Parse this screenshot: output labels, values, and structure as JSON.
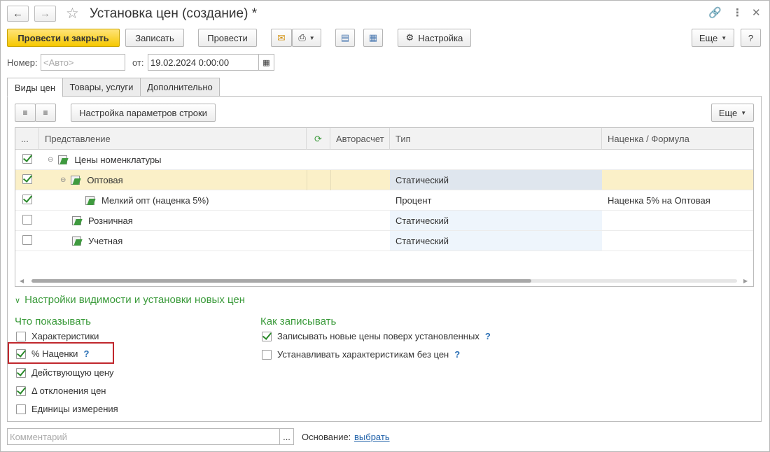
{
  "window": {
    "title": "Установка цен (создание) *"
  },
  "toolbar": {
    "post_close": "Провести и закрыть",
    "save": "Записать",
    "post": "Провести",
    "settings": "Настройка",
    "more": "Еще",
    "help": "?"
  },
  "header_fields": {
    "number_label": "Номер:",
    "number_placeholder": "<Авто>",
    "date_label": "от:",
    "date_value": "19.02.2024  0:00:00"
  },
  "tabs": [
    {
      "label": "Виды цен"
    },
    {
      "label": "Товары, услуги"
    },
    {
      "label": "Дополнительно"
    }
  ],
  "grid_toolbar": {
    "row_params": "Настройка параметров строки",
    "more": "Еще"
  },
  "grid": {
    "columns": {
      "dots": "...",
      "repr": "Представление",
      "auto": "Авторасчет",
      "type": "Тип",
      "markup": "Наценка / Формула"
    },
    "rows": [
      {
        "checked": true,
        "name": "Цены номенклатуры",
        "type": "",
        "markup": ""
      },
      {
        "checked": true,
        "name": "Оптовая",
        "type": "Статический",
        "markup": ""
      },
      {
        "checked": true,
        "name": "Мелкий опт (наценка 5%)",
        "type": "Процент",
        "markup": "Наценка 5% на Оптовая"
      },
      {
        "checked": false,
        "name": "Розничная",
        "type": "Статический",
        "markup": ""
      },
      {
        "checked": false,
        "name": "Учетная",
        "type": "Статический",
        "markup": ""
      }
    ]
  },
  "visibility": {
    "title": "Настройки видимости и установки новых цен",
    "show_title": "Что показывать",
    "show_options": [
      {
        "label": "Характеристики",
        "checked": false
      },
      {
        "label": "% Наценки",
        "checked": true,
        "help": "?"
      },
      {
        "label": "Действующую цену",
        "checked": true
      },
      {
        "label": "Δ отклонения цен",
        "checked": true
      },
      {
        "label": "Единицы измерения",
        "checked": false
      }
    ],
    "write_title": "Как записывать",
    "write_options": [
      {
        "label": "Записывать новые цены поверх установленных",
        "checked": true,
        "help": "?"
      },
      {
        "label": "Устанавливать характеристикам без цен",
        "checked": false,
        "help": "?"
      }
    ]
  },
  "footer": {
    "comment_placeholder": "Комментарий",
    "basis_label": "Основание:",
    "basis_link": "выбрать",
    "dots": "..."
  },
  "colors": {
    "accent": "#f6c800",
    "section_green": "#3a9a3a",
    "selected_row": "#fbf0c8",
    "highlight_border": "#c0272d"
  }
}
